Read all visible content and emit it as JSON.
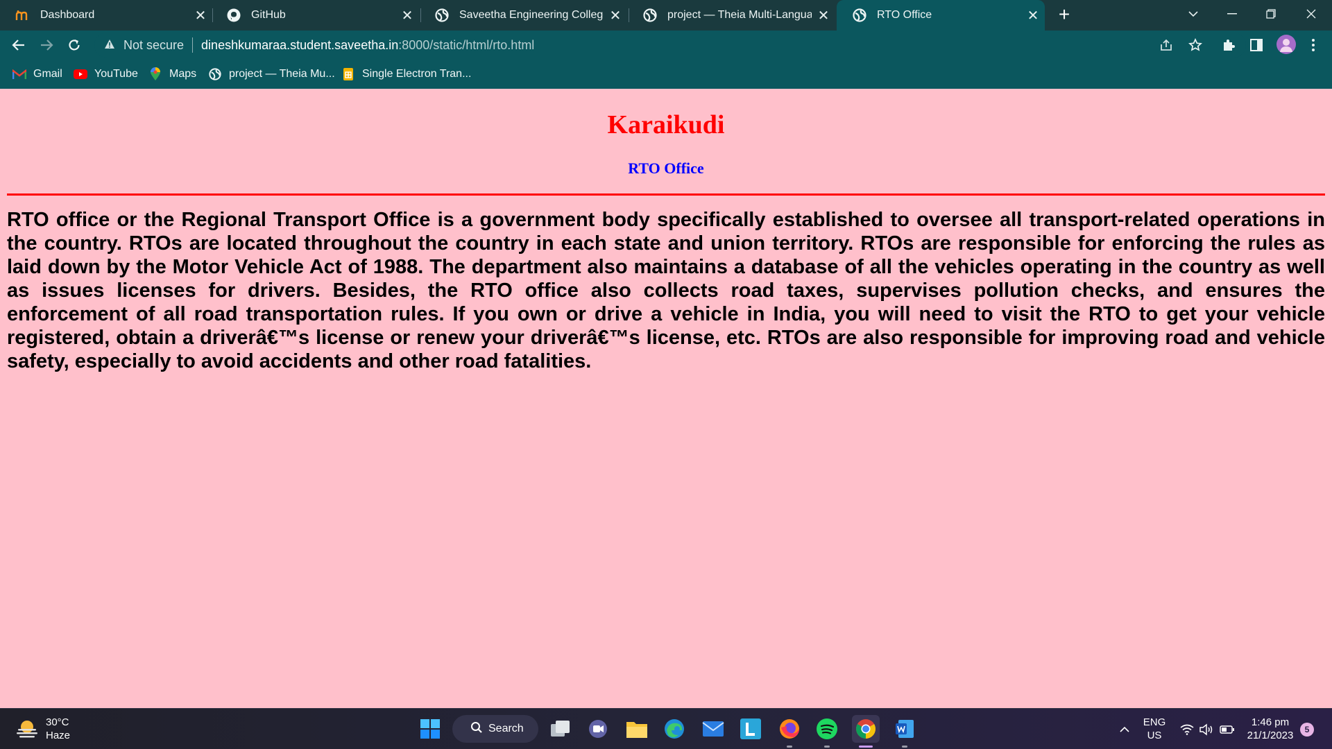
{
  "browser": {
    "tabs": [
      {
        "title": "Dashboard",
        "icon": "moodle-icon"
      },
      {
        "title": "GitHub",
        "icon": "github-icon"
      },
      {
        "title": "Saveetha Engineering College",
        "icon": "globe-icon"
      },
      {
        "title": "project — Theia Multi-Language",
        "icon": "globe-icon"
      },
      {
        "title": "RTO Office",
        "icon": "globe-icon",
        "active": true
      }
    ],
    "address": {
      "security_label": "Not secure",
      "host": "dineshkumaraa.student.saveetha.in",
      "path": ":8000/static/html/rto.html"
    },
    "bookmarks": [
      {
        "label": "Gmail",
        "icon": "gmail-icon"
      },
      {
        "label": "YouTube",
        "icon": "youtube-icon"
      },
      {
        "label": "Maps",
        "icon": "maps-icon"
      },
      {
        "label": "project — Theia Mu...",
        "icon": "globe-icon"
      },
      {
        "label": "Single Electron Tran...",
        "icon": "sheets-icon"
      }
    ]
  },
  "page": {
    "heading": "Karaikudi",
    "subheading": "RTO Office",
    "body": "RTO office or the Regional Transport Office is a government body specifically established to oversee all transport-related operations in the country. RTOs are located throughout the country in each state and union territory. RTOs are responsible for enforcing the rules as laid down by the Motor Vehicle Act of 1988. The department also maintains a database of all the vehicles operating in the country as well as issues licenses for drivers. Besides, the RTO office also collects road taxes, supervises pollution checks, and ensures the enforcement of all road transportation rules. If you own or drive a vehicle in India, you will need to visit the RTO to get your vehicle registered, obtain a driverâ€™s license or renew your driverâ€™s license, etc. RTOs are also responsible for improving road and vehicle safety, especially to avoid accidents and other road fatalities.",
    "colors": {
      "background": "#ffc0cb",
      "heading": "#ff0000",
      "subheading": "#0000ff",
      "rule": "#ff0000"
    }
  },
  "taskbar": {
    "weather": {
      "temp": "30°C",
      "condition": "Haze"
    },
    "search_label": "Search",
    "lang": {
      "line1": "ENG",
      "line2": "US"
    },
    "clock": {
      "time": "1:46 pm",
      "date": "21/1/2023"
    },
    "notification_count": "5"
  }
}
